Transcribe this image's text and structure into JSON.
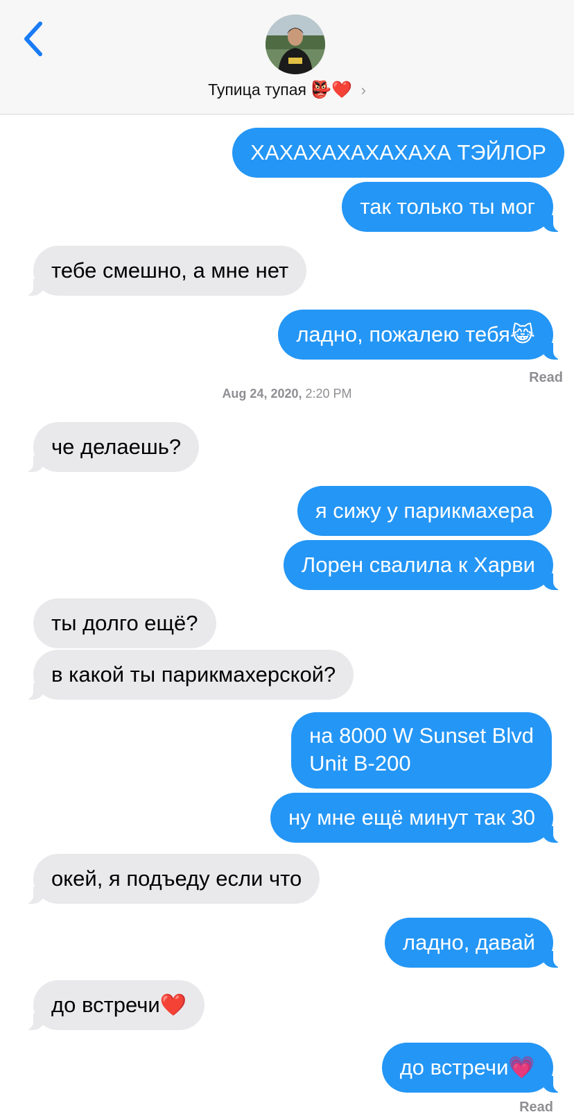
{
  "header": {
    "contact_name": "Тупица тупая",
    "name_emoji": "👺❤️",
    "avatar_icon": "avatar-photo"
  },
  "messages": [
    {
      "dir": "out",
      "text": "ХАХАХАХАХАХАХА ТЭЙЛОР"
    },
    {
      "dir": "out",
      "text": "так только ты мог"
    },
    {
      "dir": "in",
      "text": "тебе смешно, а мне нет"
    },
    {
      "dir": "out",
      "text": "ладно, пожалею тебя😹"
    },
    {
      "dir": "in",
      "text": "че делаешь?"
    },
    {
      "dir": "out",
      "text": "я сижу у парикмахера"
    },
    {
      "dir": "out",
      "text": "Лорен свалила к Харви"
    },
    {
      "dir": "in",
      "text": "ты долго ещё?"
    },
    {
      "dir": "in",
      "text": "в какой ты парикмахерской?"
    },
    {
      "dir": "out",
      "line1": "на 8000 W Sunset Blvd",
      "line2": "Unit B-200"
    },
    {
      "dir": "out",
      "text": "ну мне ещё минут так 30"
    },
    {
      "dir": "in",
      "text": "окей, я подъеду если что"
    },
    {
      "dir": "out",
      "text": "ладно, давай"
    },
    {
      "dir": "in",
      "text": "до встречи❤️"
    },
    {
      "dir": "out",
      "text": "до встречи💗"
    }
  ],
  "status": {
    "read_1": "Read",
    "read_2": "Read",
    "timestamp_date": "Aug 24, 2020,",
    "timestamp_time": "2:20 PM"
  },
  "colors": {
    "outgoing_bubble": "#2496f5",
    "incoming_bubble": "#e9e9eb",
    "back_chevron": "#1a7cf5"
  }
}
